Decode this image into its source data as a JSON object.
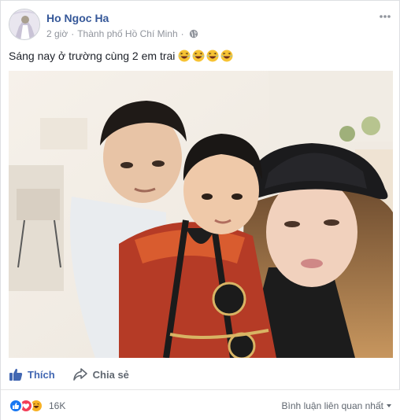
{
  "post": {
    "author": "Ho Ngoc Ha",
    "time": "2 giờ",
    "separator": "·",
    "location": "Thành phố Hồ Chí Minh",
    "privacy_icon": "globe-icon",
    "more_icon": "more-options-icon",
    "caption": "Sáng nay ở trường cùng 2 em trai",
    "caption_emojis": [
      "laughing-emoji",
      "laughing-emoji",
      "laughing-emoji",
      "laughing-emoji"
    ]
  },
  "actions": {
    "like_label": "Thích",
    "share_label": "Chia sẻ"
  },
  "footer": {
    "reaction_icons": [
      "like-reaction-icon",
      "love-reaction-icon",
      "haha-reaction-icon"
    ],
    "reaction_count": "16K",
    "sort_label": "Bình luận liên quan nhất"
  },
  "colors": {
    "link_blue": "#365899",
    "action_blue": "#4267b2",
    "meta_gray": "#90949c",
    "like_blue": "#1877f2",
    "love_red": "#f33e58",
    "haha_yellow": "#f7b125"
  }
}
